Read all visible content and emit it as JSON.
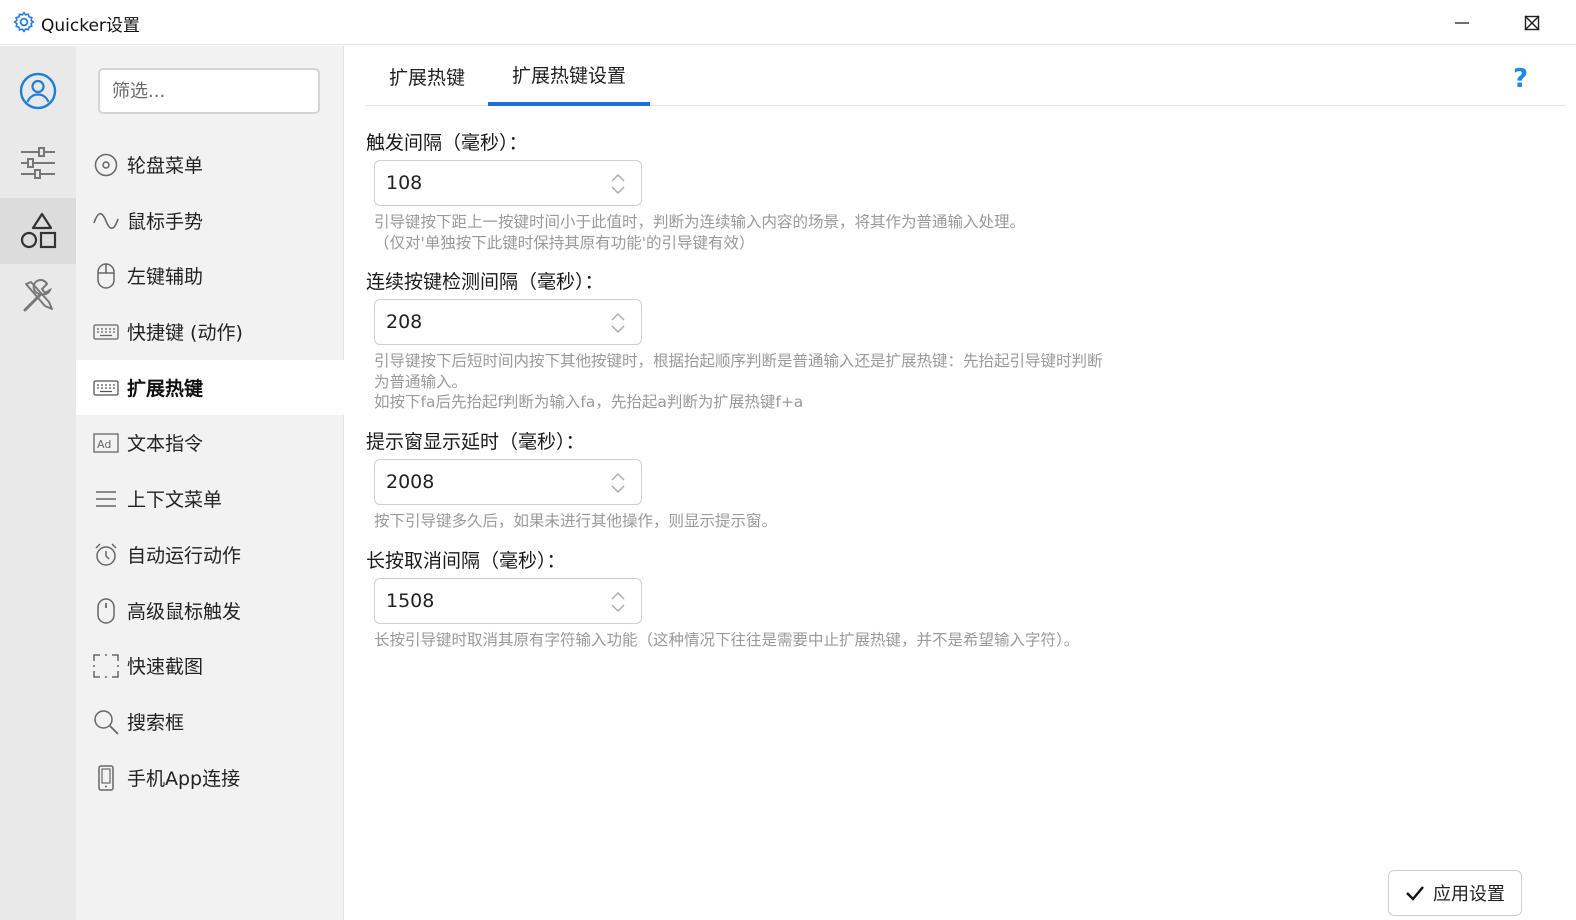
{
  "window": {
    "title": "Quicker设置",
    "icons": {
      "app": "gear-icon",
      "minimize": "minimize-icon",
      "maximize": "maximize-icon",
      "close": "close-icon"
    }
  },
  "rail": {
    "items": [
      {
        "icon": "user-avatar-icon",
        "active": false
      },
      {
        "icon": "sliders-icon",
        "active": false
      },
      {
        "icon": "shapes-icon",
        "active": true
      },
      {
        "icon": "tools-icon",
        "active": false
      }
    ]
  },
  "menu": {
    "filter_placeholder": "筛选...",
    "items": [
      {
        "label": "轮盘菜单",
        "icon": "wheel-icon"
      },
      {
        "label": "鼠标手势",
        "icon": "gesture-wave-icon"
      },
      {
        "label": "左键辅助",
        "icon": "mouse-icon"
      },
      {
        "label": "快捷键 (动作)",
        "icon": "keyboard-icon"
      },
      {
        "label": "扩展热键",
        "icon": "keyboard-icon",
        "active": true
      },
      {
        "label": "文本指令",
        "icon": "ad-text-icon"
      },
      {
        "label": "上下文菜单",
        "icon": "list-lines-icon"
      },
      {
        "label": "自动运行动作",
        "icon": "alarm-clock-icon"
      },
      {
        "label": "高级鼠标触发",
        "icon": "mouse-icon"
      },
      {
        "label": "快速截图",
        "icon": "screenshot-frame-icon"
      },
      {
        "label": "搜索框",
        "icon": "search-icon"
      },
      {
        "label": "手机App连接",
        "icon": "phone-icon"
      }
    ]
  },
  "tabs": [
    {
      "label": "扩展热键",
      "active": false
    },
    {
      "label": "扩展热键设置",
      "active": true
    }
  ],
  "help_label": "?",
  "settings": [
    {
      "label": "触发间隔（毫秒）：",
      "value": "108",
      "desc": [
        "引导键按下距上一按键时间小于此值时，判断为连续输入内容的场景，将其作为普通输入处理。",
        "（仅对'单独按下此键时保持其原有功能'的引导键有效）"
      ]
    },
    {
      "label": "连续按键检测间隔（毫秒）：",
      "value": "208",
      "desc": [
        "引导键按下后短时间内按下其他按键时，根据抬起顺序判断是普通输入还是扩展热键：先抬起引导键时判断",
        "为普通输入。",
        "如按下fa后先抬起f判断为输入fa，先抬起a判断为扩展热键f+a"
      ]
    },
    {
      "label": "提示窗显示延时（毫秒）：",
      "value": "2008",
      "desc": [
        "按下引导键多久后，如果未进行其他操作，则显示提示窗。"
      ]
    },
    {
      "label": "长按取消间隔（毫秒）：",
      "value": "1508",
      "desc": [
        "长按引导键时取消其原有字符输入功能（这种情况下往往是需要中止扩展热键，并不是希望输入字符）。"
      ]
    }
  ],
  "apply_label": "应用设置",
  "colors": {
    "accent": "#1e6fd9",
    "help": "#1e88e5",
    "hint": "#9a9a9a"
  }
}
